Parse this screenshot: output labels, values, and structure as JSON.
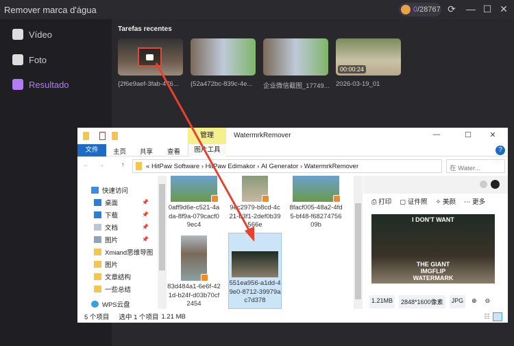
{
  "app": {
    "title": "Remover marca d'água",
    "credits_used": "0",
    "credits_total": "/28767"
  },
  "sidebar": {
    "items": [
      {
        "label": "Vídeo"
      },
      {
        "label": "Foto"
      },
      {
        "label": "Resultado"
      }
    ]
  },
  "main": {
    "section_title": "Tarefas recentes",
    "tasks": [
      {
        "label": "{2f6e9aef-3fab-476..."
      },
      {
        "label": "{52a472bc-839c-4e..."
      },
      {
        "label": "企业微信截图_17749..."
      },
      {
        "label": "2026-03-19_01",
        "duration": "00:00:24"
      }
    ]
  },
  "explorer": {
    "context_tab": "管理",
    "title": "WatermrkRemover",
    "tabs": [
      "文件",
      "主页",
      "共享",
      "查看",
      "图片工具"
    ],
    "path": [
      "«",
      "HitPaw Software",
      "›",
      "HitPaw Edimakor",
      "›",
      "AI Generator",
      "›",
      "WatermrkRemover"
    ],
    "search_placeholder": "在 Water...",
    "nav": [
      {
        "label": "快速访问"
      },
      {
        "label": "桌面"
      },
      {
        "label": "下载"
      },
      {
        "label": "文档"
      },
      {
        "label": "图片"
      },
      {
        "label": "Xmiand思维导图"
      },
      {
        "label": "图片"
      },
      {
        "label": "文章结构"
      },
      {
        "label": "一些总结"
      },
      {
        "label": "WPS云盘"
      }
    ],
    "files": [
      {
        "name": "0aff9d6e-c521-4ada-8f9a-079cacf09ec4"
      },
      {
        "name": "9ec2979-b8cd-4c21-b3f1-2def0b39566e"
      },
      {
        "name": "8facf005-48a2-4fd5-bf48-f6827475609b"
      },
      {
        "name": "83d484a1-6e6f-421d-b24f-d03b70cf2454"
      },
      {
        "name": "551ea956-a1dd-49e0-8712-39979ac7d378"
      }
    ],
    "preview": {
      "actions": [
        "打印",
        "证件照",
        "美颜",
        "更多"
      ],
      "caption_top": "I DON'T WANT",
      "caption_bottom": "THE GIANT IMGFLIP WATERMARK",
      "size": "1.21MB",
      "dims": "2848*1600像素",
      "format": "JPG"
    },
    "status": {
      "count": "5 个项目",
      "selected": "选中 1 个项目",
      "size": "1.21 MB"
    }
  },
  "colors": {
    "accent": "#b27cf5",
    "highlight": "#e04a3a",
    "explorer_blue": "#1c6bc4"
  }
}
